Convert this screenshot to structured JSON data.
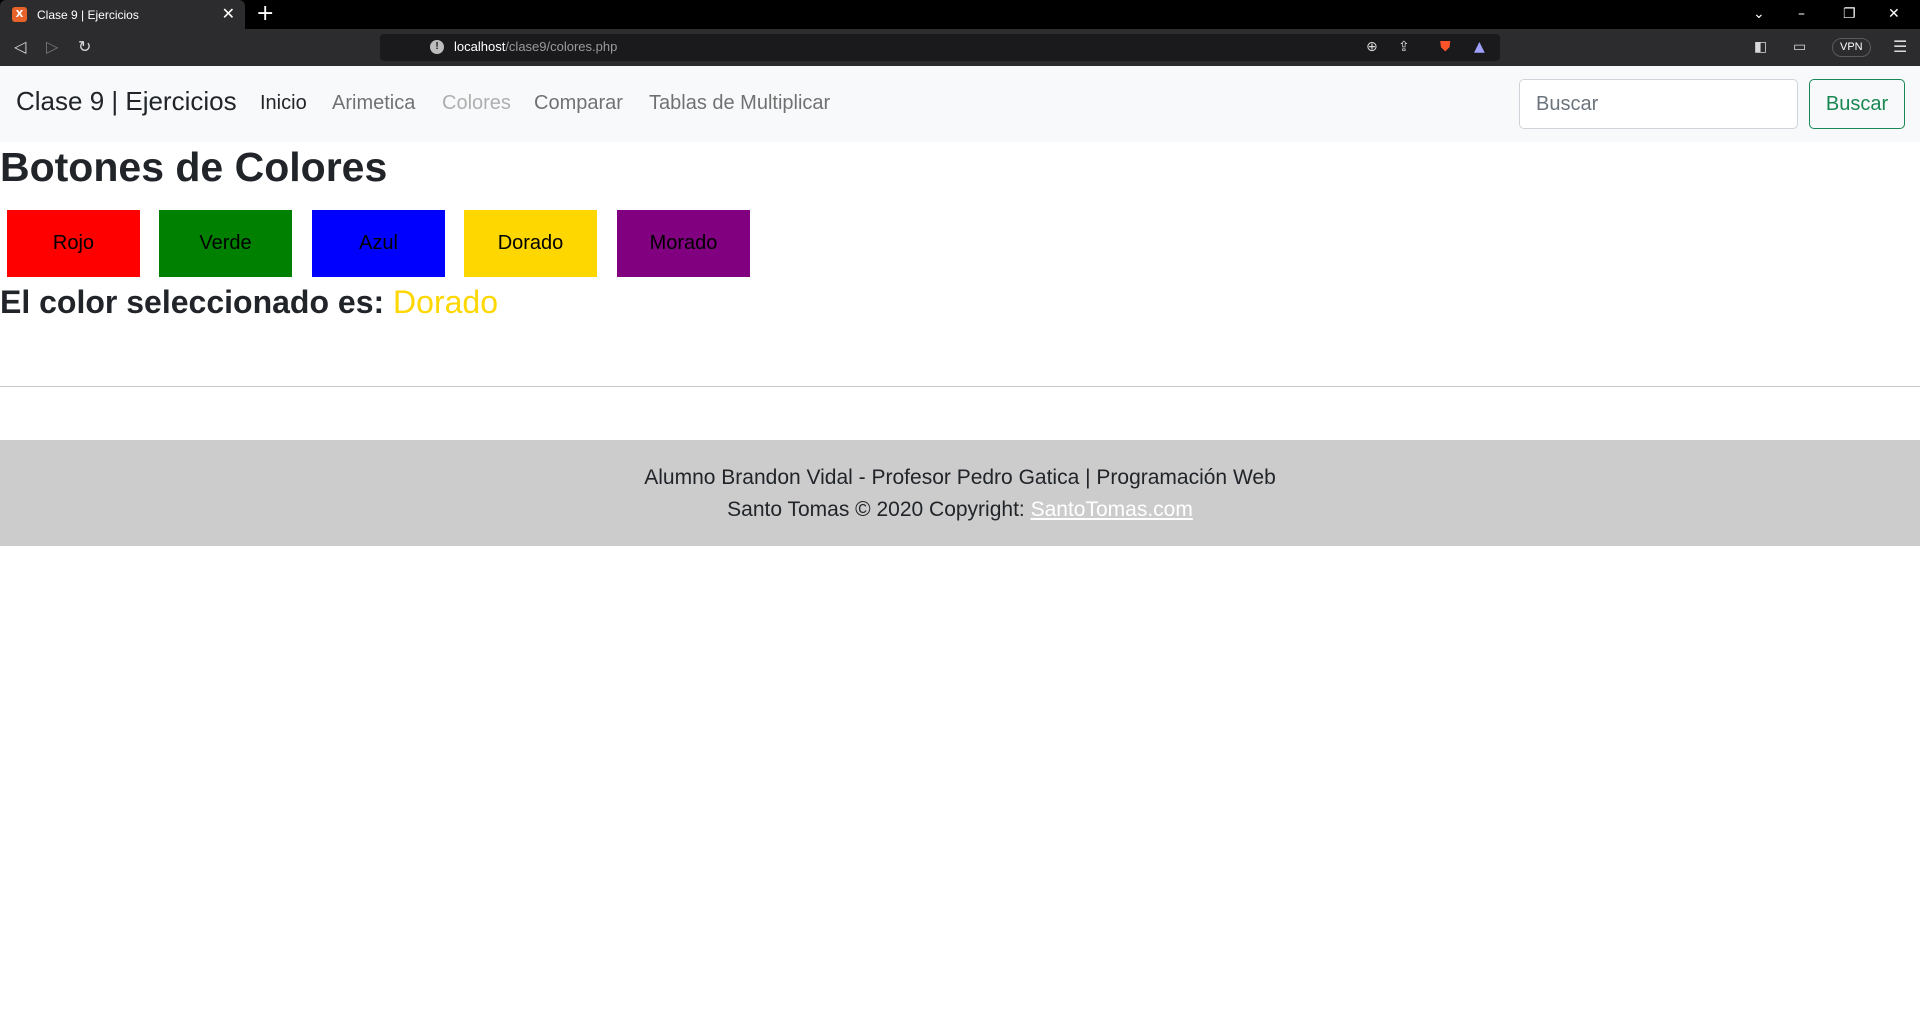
{
  "browser": {
    "tab_title": "Clase 9 | Ejercicios",
    "tab_favicon": "X",
    "url_host": "localhost",
    "url_path": "/clase9/colores.php",
    "vpn_label": "VPN",
    "icons": {
      "back": "back-arrow-icon",
      "forward": "forward-arrow-icon",
      "reload": "reload-icon",
      "bookmark": "bookmark-icon",
      "info": "site-info-icon",
      "zoom": "zoom-icon",
      "share": "share-icon",
      "brave_shield": "brave-shield-icon",
      "rewards": "brave-rewards-icon",
      "sidebar": "sidebar-icon",
      "wallet": "wallet-icon",
      "menu": "menu-icon"
    }
  },
  "navbar": {
    "brand": "Clase 9 | Ejercicios",
    "links": [
      {
        "label": "Inicio",
        "state": "active"
      },
      {
        "label": "Arimetica",
        "state": "normal"
      },
      {
        "label": "Colores",
        "state": "disabled"
      },
      {
        "label": "Comparar",
        "state": "normal"
      },
      {
        "label": "Tablas de Multiplicar",
        "state": "normal"
      }
    ],
    "search_placeholder": "Buscar",
    "search_button": "Buscar",
    "search_button_color": "#198754"
  },
  "main": {
    "heading": "Botones de Colores",
    "buttons": [
      {
        "label": "Rojo",
        "color": "#ff0000"
      },
      {
        "label": "Verde",
        "color": "#008000"
      },
      {
        "label": "Azul",
        "color": "#0000ff"
      },
      {
        "label": "Dorado",
        "color": "#ffd700"
      },
      {
        "label": "Morado",
        "color": "#800080"
      }
    ],
    "selected_prefix": "El color seleccionado es:",
    "selected_value": "Dorado",
    "selected_color": "#ffd700"
  },
  "footer": {
    "line1": "Alumno Brandon Vidal - Profesor Pedro Gatica | Programación Web",
    "line2_prefix": "Santo Tomas © 2020 Copyright:",
    "link_text": "SantoTomas.com",
    "background": "#cccccc"
  }
}
